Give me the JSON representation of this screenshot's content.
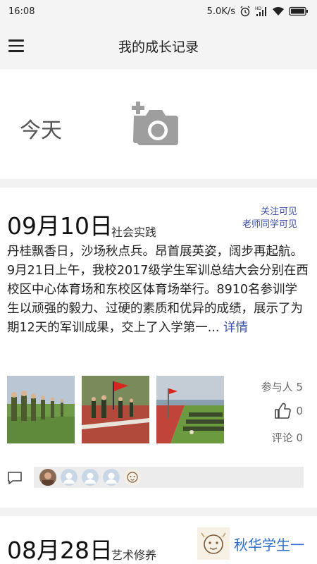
{
  "status_bar": {
    "time": "16:08",
    "speed": "5.0K/s"
  },
  "app_bar": {
    "title": "我的成长记录",
    "menu_icon": "hamburger-menu-icon"
  },
  "today": {
    "label": "今天",
    "add_icon": "add-photo-icon"
  },
  "posts": [
    {
      "date": "09月10日",
      "category": "社会实践",
      "visibility": [
        "关注可见",
        "老师同学可见"
      ],
      "body": "丹桂飘香日，沙场秋点兵。昂首展英姿，阔步再起航。9月21日上午，我校2017级学生军训总结大会分别在西校区中心体育场和东校区体育场举行。8910名参训学生以顽强的毅力、过硬的素质和优异的成绩，展示了为期12天的军训成果，交上了入学第一...",
      "more": "详情",
      "photos": [
        "military-drill-photo",
        "parade-flag-photo",
        "stadium-formation-photo"
      ],
      "participants": "参与人 5",
      "likes": "0",
      "comments": "评论 0",
      "avatars": [
        "user-avatar",
        "default-avatar",
        "default-avatar",
        "default-avatar",
        "cartoon-avatar"
      ]
    },
    {
      "date": "08月28日",
      "category": "艺术修养",
      "badge_label": "秋华学生一"
    }
  ],
  "colors": {
    "accent": "#3d4fa8",
    "badge": "#2f6fd0",
    "background": "#f2f2f2"
  }
}
